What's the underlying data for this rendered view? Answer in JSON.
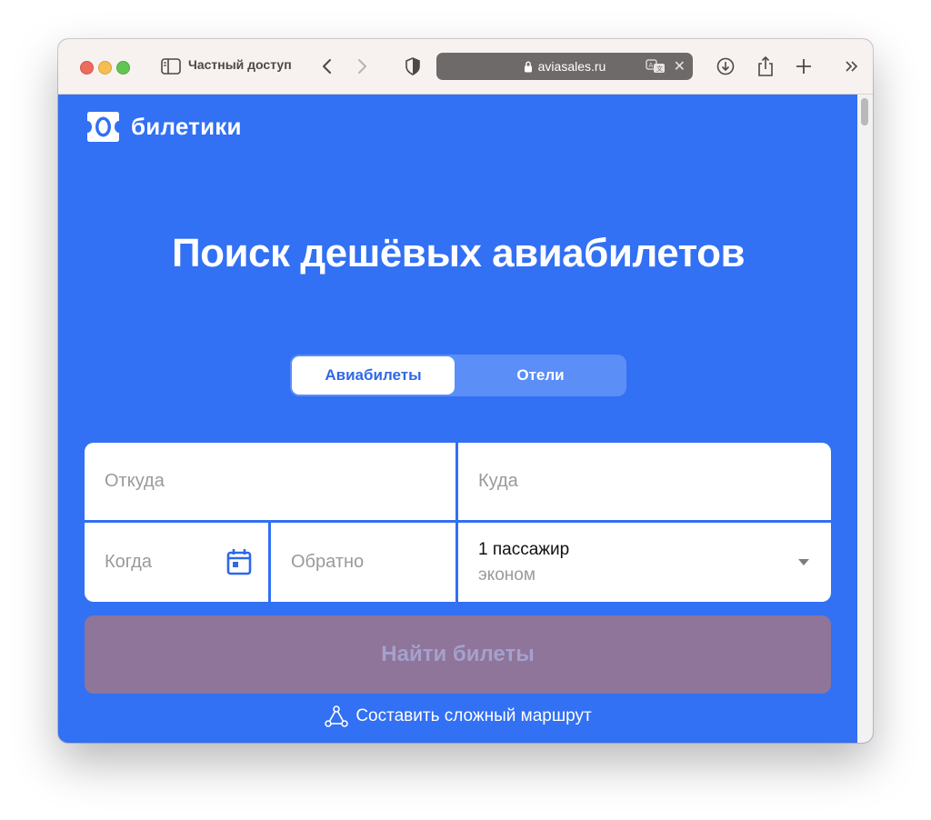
{
  "browser": {
    "tab_group_label": "Частный доступ",
    "address": "aviasales.ru",
    "icons": [
      "sidebar-icon",
      "back-icon",
      "forward-icon",
      "shield-icon",
      "lock-icon",
      "translate-icon",
      "close-icon",
      "download-icon",
      "share-icon",
      "plus-icon",
      "more-icon"
    ]
  },
  "site": {
    "logo_text": "билетики",
    "headline": "Поиск дешёвых авиабилетов",
    "tabs": [
      {
        "label": "Авиабилеты",
        "active": true
      },
      {
        "label": "Отели",
        "active": false
      }
    ],
    "form": {
      "from_placeholder": "Откуда",
      "to_placeholder": "Куда",
      "when_placeholder": "Когда",
      "return_placeholder": "Обратно",
      "passengers": "1 пассажир",
      "class": "эконом"
    },
    "search_button": "Найти билеты",
    "complex_route": "Составить сложный маршрут"
  },
  "colors": {
    "brand_blue": "#3270f4",
    "button_disabled": "#8e7599",
    "white": "#ffffff"
  }
}
